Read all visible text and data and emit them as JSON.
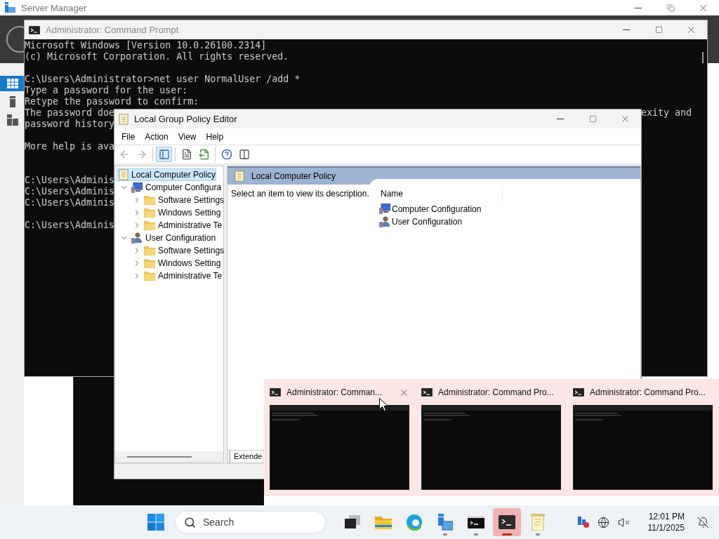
{
  "server_manager": {
    "title": "Server Manager",
    "nav_items": [
      {
        "kind": "dashboard",
        "selected": true
      },
      {
        "kind": "server",
        "selected": false
      },
      {
        "kind": "servers",
        "selected": false
      }
    ]
  },
  "command_prompt": {
    "title": "Administrator: Command Prompt",
    "lines": [
      {
        "kind": "text",
        "text": "Microsoft Windows [Version 10.0.26100.2314]"
      },
      {
        "kind": "text",
        "text": "(c) Microsoft Corporation. All rights reserved."
      },
      {
        "kind": "blank"
      },
      {
        "kind": "text",
        "text": "C:\\Users\\Administrator>net user NormalUser /add *"
      },
      {
        "kind": "text",
        "text": "Type a password for the user:"
      },
      {
        "kind": "text",
        "text": "Retype the password to confirm:"
      },
      {
        "kind": "text",
        "text": "The password doe",
        "right": "exity and"
      },
      {
        "kind": "text",
        "text": "password history"
      },
      {
        "kind": "blank"
      },
      {
        "kind": "text",
        "text": "More help is ava"
      },
      {
        "kind": "blank"
      },
      {
        "kind": "blank"
      },
      {
        "kind": "text",
        "text": "C:\\Users\\Adminis"
      },
      {
        "kind": "text",
        "text": "C:\\Users\\Adminis"
      },
      {
        "kind": "text",
        "text": "C:\\Users\\Adminis"
      },
      {
        "kind": "blank"
      },
      {
        "kind": "text",
        "text": "C:\\Users\\Adminis"
      }
    ]
  },
  "policy_editor": {
    "title": "Local Group Policy Editor",
    "menu": [
      "File",
      "Action",
      "View",
      "Help"
    ],
    "toolbar": [
      {
        "kind": "back",
        "disabled": true,
        "pressed": false
      },
      {
        "kind": "forward",
        "disabled": true,
        "pressed": false
      },
      {
        "kind": "tree",
        "disabled": false,
        "pressed": true
      },
      {
        "kind": "properties",
        "disabled": false,
        "pressed": false
      },
      {
        "kind": "export",
        "disabled": false,
        "pressed": false
      },
      {
        "kind": "help",
        "disabled": false,
        "pressed": false
      },
      {
        "kind": "view",
        "disabled": false,
        "pressed": false
      }
    ],
    "tree": [
      {
        "label": "Local Computer Policy",
        "kind": "policy",
        "selected": true,
        "children": [
          {
            "label": "Computer Configura",
            "kind": "computer",
            "selected": false,
            "expanded": true,
            "children": [
              {
                "label": "Software Settings",
                "kind": "folder",
                "selected": false,
                "expanded": false
              },
              {
                "label": "Windows Setting",
                "kind": "folder",
                "selected": false,
                "expanded": false
              },
              {
                "label": "Administrative Te",
                "kind": "folder",
                "selected": false,
                "expanded": false
              }
            ]
          },
          {
            "label": "User Configuration",
            "kind": "user",
            "selected": false,
            "expanded": true,
            "children": [
              {
                "label": "Software Settings",
                "kind": "folder",
                "selected": false,
                "expanded": false
              },
              {
                "label": "Windows Setting",
                "kind": "folder",
                "selected": false,
                "expanded": false
              },
              {
                "label": "Administrative Te",
                "kind": "folder",
                "selected": false,
                "expanded": false
              }
            ]
          }
        ]
      }
    ],
    "detail": {
      "header": "Local Computer Policy",
      "description": "Select an item to view its description.",
      "column": "Name",
      "items": [
        {
          "label": "Computer Configuration",
          "kind": "computer"
        },
        {
          "label": "User Configuration",
          "kind": "user"
        }
      ],
      "tabs": [
        {
          "label": "Extende",
          "selected": true
        }
      ]
    }
  },
  "switcher": [
    {
      "title": "Administrator: Comman...",
      "hovered": true
    },
    {
      "title": "Administrator: Command Pro...",
      "hovered": false
    },
    {
      "title": "Administrator: Command Pro...",
      "hovered": false
    }
  ],
  "taskbar": {
    "search_placeholder": "Search",
    "apps": [
      {
        "kind": "task-view",
        "running": false,
        "selected": false
      },
      {
        "kind": "folder",
        "running": false,
        "selected": false
      },
      {
        "kind": "browser",
        "running": false,
        "selected": false
      },
      {
        "kind": "server-manager",
        "running": true,
        "selected": false
      },
      {
        "kind": "cmd",
        "running": true,
        "selected": false
      },
      {
        "kind": "terminal",
        "running": true,
        "selected": true
      },
      {
        "kind": "notepad",
        "running": true,
        "selected": false
      }
    ],
    "tray": [
      {
        "kind": "network"
      },
      {
        "kind": "globe"
      },
      {
        "kind": "muted"
      }
    ],
    "time": "12:01 PM",
    "date": "11/1/2025"
  }
}
